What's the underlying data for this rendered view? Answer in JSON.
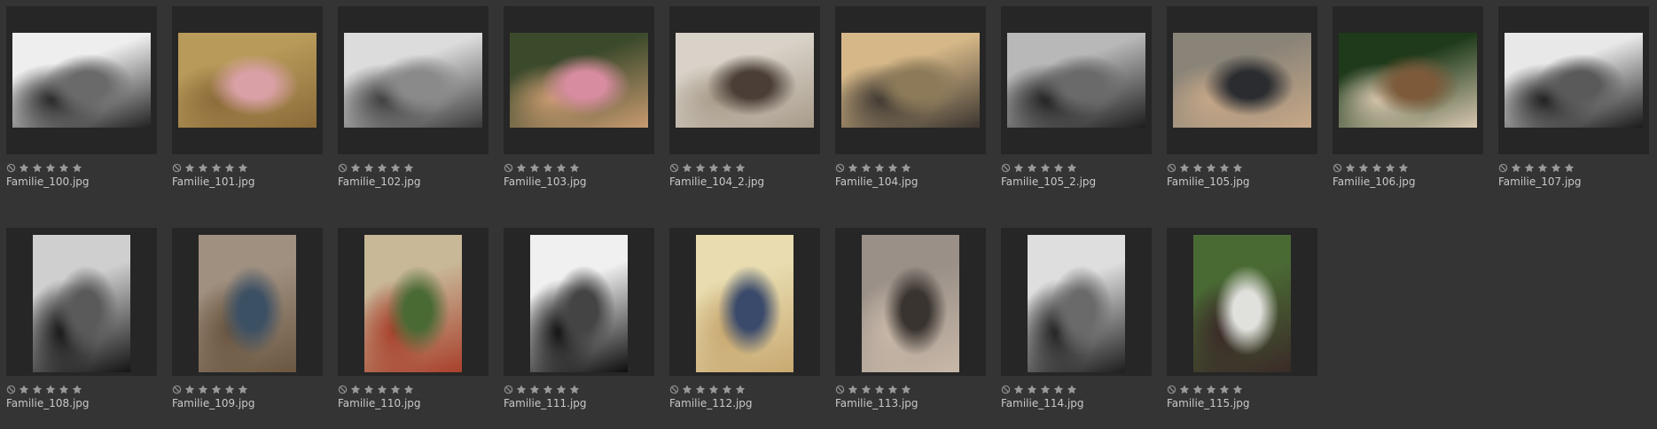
{
  "gallery": {
    "items": [
      {
        "filename": "Familie_100.jpg",
        "tone": "bw",
        "orientation": "landscape",
        "colors": [
          "#eeeeee",
          "#6a6a6a",
          "#222222"
        ]
      },
      {
        "filename": "Familie_101.jpg",
        "tone": "color",
        "orientation": "landscape",
        "colors": [
          "#b89a5a",
          "#d9a0a6",
          "#8a6a38"
        ]
      },
      {
        "filename": "Familie_102.jpg",
        "tone": "bw",
        "orientation": "landscape",
        "colors": [
          "#dcdcdc",
          "#8a8a8a",
          "#3a3a3a"
        ]
      },
      {
        "filename": "Familie_103.jpg",
        "tone": "color",
        "orientation": "landscape",
        "colors": [
          "#3c4a2c",
          "#d88ca0",
          "#c89a70"
        ]
      },
      {
        "filename": "Familie_104_2.jpg",
        "tone": "color",
        "orientation": "landscape",
        "colors": [
          "#d8d2c8",
          "#4a3e36",
          "#a89b8a"
        ]
      },
      {
        "filename": "Familie_104.jpg",
        "tone": "color",
        "orientation": "landscape",
        "colors": [
          "#d6b888",
          "#8c7a58",
          "#3c3630"
        ]
      },
      {
        "filename": "Familie_105_2.jpg",
        "tone": "bw",
        "orientation": "landscape",
        "colors": [
          "#b8b8b8",
          "#6a6a6a",
          "#1e1e1e"
        ]
      },
      {
        "filename": "Familie_105.jpg",
        "tone": "color",
        "orientation": "landscape",
        "colors": [
          "#8a8478",
          "#2a2c30",
          "#c8a888"
        ]
      },
      {
        "filename": "Familie_106.jpg",
        "tone": "color",
        "orientation": "landscape",
        "colors": [
          "#1e3a1a",
          "#7c5a3a",
          "#d8c8b0"
        ]
      },
      {
        "filename": "Familie_107.jpg",
        "tone": "bw",
        "orientation": "landscape",
        "colors": [
          "#e8e8e8",
          "#5a5a5a",
          "#1a1a1a"
        ]
      },
      {
        "filename": "Familie_108.jpg",
        "tone": "bw",
        "orientation": "portrait",
        "colors": [
          "#cfcfcf",
          "#5a5a5a",
          "#141414"
        ]
      },
      {
        "filename": "Familie_109.jpg",
        "tone": "color",
        "orientation": "portrait",
        "colors": [
          "#a09080",
          "#3c5064",
          "#6a5640"
        ]
      },
      {
        "filename": "Familie_110.jpg",
        "tone": "color",
        "orientation": "portrait",
        "colors": [
          "#c8b898",
          "#4a6a34",
          "#a8402c"
        ]
      },
      {
        "filename": "Familie_111.jpg",
        "tone": "bw",
        "orientation": "portrait",
        "colors": [
          "#f0f0f0",
          "#444444",
          "#0e0e0e"
        ]
      },
      {
        "filename": "Familie_112.jpg",
        "tone": "color",
        "orientation": "portrait",
        "colors": [
          "#e8dcb0",
          "#3a4a6a",
          "#c8a870"
        ]
      },
      {
        "filename": "Familie_113.jpg",
        "tone": "color",
        "orientation": "portrait",
        "colors": [
          "#9a9088",
          "#3a3430",
          "#c8b8a8"
        ]
      },
      {
        "filename": "Familie_114.jpg",
        "tone": "bw",
        "orientation": "portrait",
        "colors": [
          "#dedede",
          "#6a6a6a",
          "#1e1e1e"
        ]
      },
      {
        "filename": "Familie_115.jpg",
        "tone": "color",
        "orientation": "portrait",
        "colors": [
          "#4a6a34",
          "#e0e0dc",
          "#3a2a28"
        ]
      }
    ],
    "rating": {
      "stars": 0,
      "max_stars": 5,
      "star_color": "#9a9a9a",
      "reject_color": "#8a8a8a"
    }
  },
  "theme": {
    "background": "#343434",
    "thumb_background": "#262626"
  }
}
